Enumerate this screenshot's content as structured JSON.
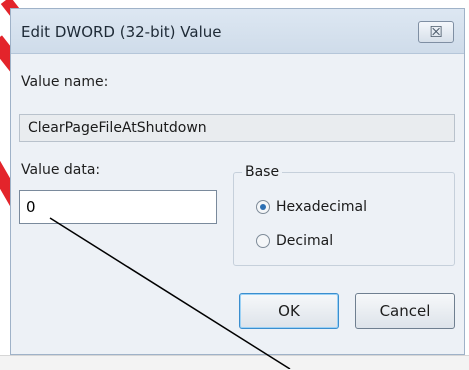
{
  "window": {
    "title": "Edit DWORD (32-bit) Value",
    "close_glyph": "☒"
  },
  "value_name": {
    "label": "Value name:",
    "value": "ClearPageFileAtShutdown"
  },
  "value_data": {
    "label": "Value data:",
    "value": "0"
  },
  "base": {
    "label": "Base",
    "options": [
      {
        "label": "Hexadecimal",
        "selected": true
      },
      {
        "label": "Decimal",
        "selected": false
      }
    ]
  },
  "buttons": {
    "ok": "OK",
    "cancel": "Cancel"
  },
  "colors": {
    "accent_red": "#e3242b",
    "dialog_bg": "#edf1f6",
    "ok_focus": "#3a8ecf"
  }
}
